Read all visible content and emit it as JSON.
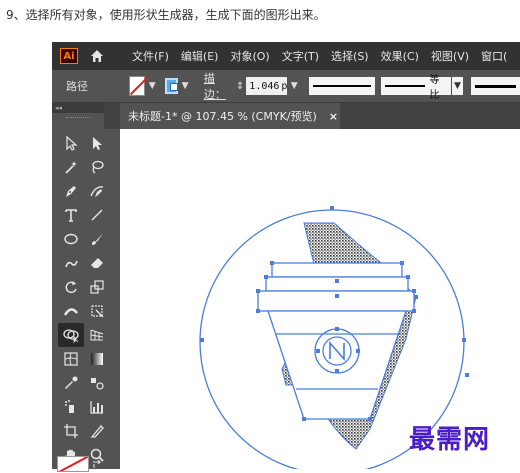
{
  "instruction": "9、选择所有对象，使用形状生成器，生成下面的图形出来。",
  "app": {
    "logo": "Ai",
    "menu": [
      "文件(F)",
      "编辑(E)",
      "对象(O)",
      "文字(T)",
      "选择(S)",
      "效果(C)",
      "视图(V)",
      "窗口("
    ]
  },
  "options_bar": {
    "selection_label": "路径",
    "stroke_label": "描边：",
    "stroke_weight": "1.046",
    "stroke_unit": "p",
    "profile_label": "等比"
  },
  "document": {
    "tab_title": "未标题-1* @ 107.45 % (CMYK/预览)",
    "close": "×"
  },
  "tools": [
    "selection-tool",
    "direct-selection-tool",
    "magic-wand-tool",
    "lasso-tool",
    "pen-tool",
    "curvature-tool",
    "type-tool",
    "line-segment-tool",
    "ellipse-tool",
    "paintbrush-tool",
    "shaper-tool",
    "eraser-tool",
    "rotate-tool",
    "scale-tool",
    "width-tool",
    "free-transform-tool",
    "shape-builder-tool",
    "perspective-grid-tool",
    "mesh-tool",
    "gradient-tool",
    "eyedropper-tool",
    "blend-tool",
    "symbol-sprayer-tool",
    "column-graph-tool",
    "artboard-tool",
    "slice-tool",
    "hand-tool",
    "zoom-tool"
  ],
  "active_tool": "shape-builder-tool",
  "watermark": "最需网",
  "colors": {
    "selection_blue": "#4a7dde",
    "menubar": "#323232",
    "panel": "#535353",
    "watermark": "#4b1cc9"
  }
}
